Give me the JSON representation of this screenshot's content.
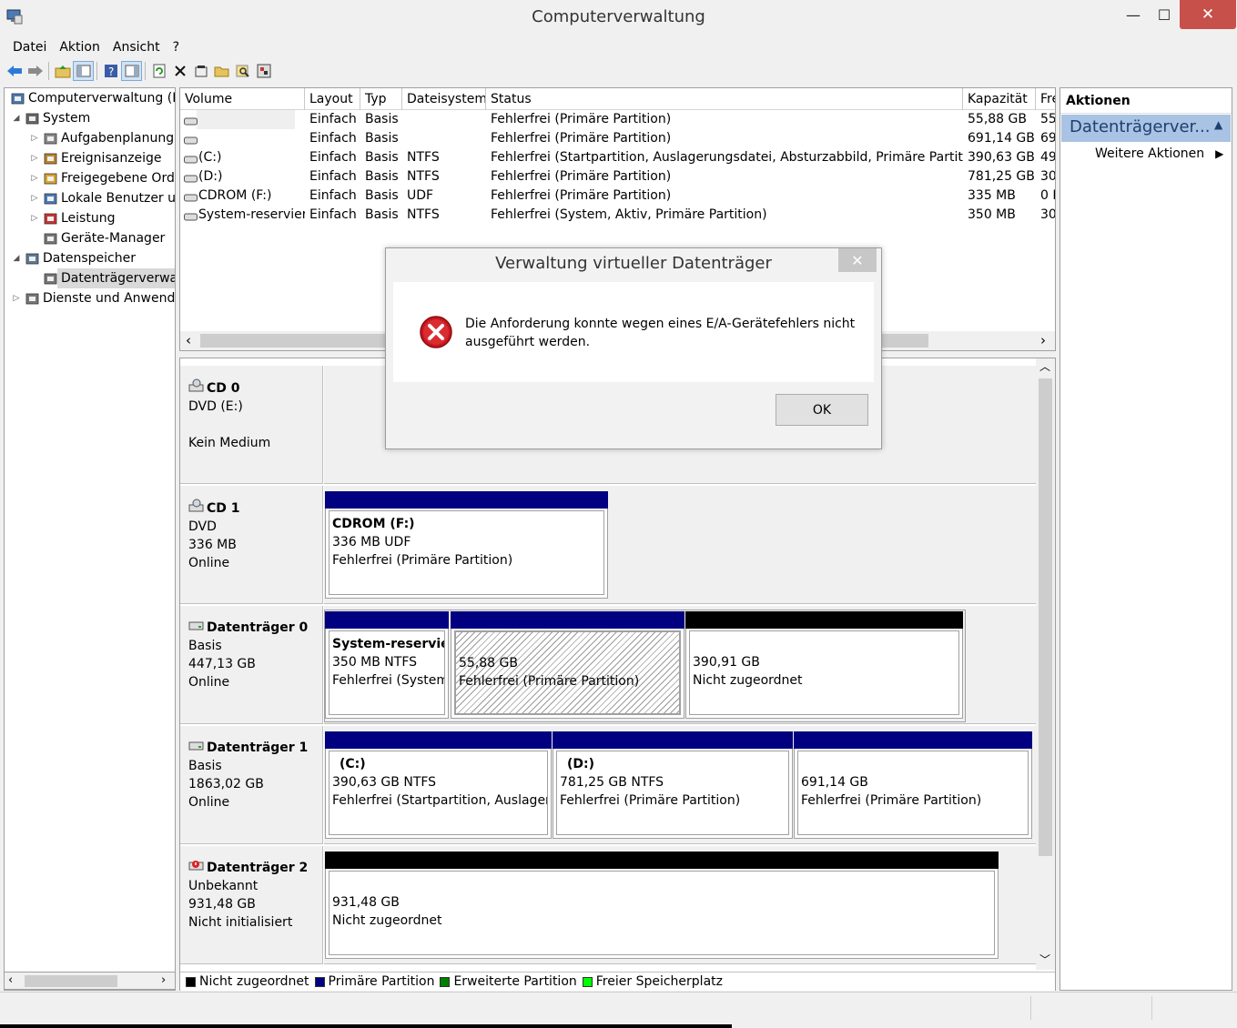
{
  "window": {
    "title": "Computerverwaltung"
  },
  "menu": [
    "Datei",
    "Aktion",
    "Ansicht",
    "?"
  ],
  "tree": {
    "items": [
      {
        "label": "Computerverwaltung (Lokal)",
        "level": 0,
        "arrow": "",
        "icon": "computer-management-icon"
      },
      {
        "label": "System",
        "level": 1,
        "arrow": "◢",
        "icon": "system-tools-icon"
      },
      {
        "label": "Aufgabenplanung",
        "level": 2,
        "arrow": "▷",
        "icon": "clock-icon"
      },
      {
        "label": "Ereignisanzeige",
        "level": 2,
        "arrow": "▷",
        "icon": "event-viewer-icon"
      },
      {
        "label": "Freigegebene Ordner",
        "level": 2,
        "arrow": "▷",
        "icon": "shared-folder-icon"
      },
      {
        "label": "Lokale Benutzer und Gruppen",
        "level": 2,
        "arrow": "▷",
        "icon": "users-icon"
      },
      {
        "label": "Leistung",
        "level": 2,
        "arrow": "▷",
        "icon": "performance-icon"
      },
      {
        "label": "Geräte-Manager",
        "level": 2,
        "arrow": "",
        "icon": "device-manager-icon"
      },
      {
        "label": "Datenspeicher",
        "level": 1,
        "arrow": "◢",
        "icon": "storage-icon"
      },
      {
        "label": "Datenträgerverwaltung",
        "level": 2,
        "arrow": "",
        "icon": "disk-management-icon",
        "selected": true
      },
      {
        "label": "Dienste und Anwendungen",
        "level": 1,
        "arrow": "▷",
        "icon": "services-icon"
      }
    ]
  },
  "volumes": {
    "columns": [
      "Volume",
      "Layout",
      "Typ",
      "Dateisystem",
      "Status",
      "Kapazität",
      "Fre"
    ],
    "rows": [
      [
        "",
        "Einfach",
        "Basis",
        "",
        "Fehlerfrei (Primäre Partition)",
        "55,88 GB",
        "55"
      ],
      [
        "",
        "Einfach",
        "Basis",
        "",
        "Fehlerfrei (Primäre Partition)",
        "691,14 GB",
        "69"
      ],
      [
        "(C:)",
        "Einfach",
        "Basis",
        "NTFS",
        "Fehlerfrei (Startpartition, Auslagerungsdatei, Absturzabbild, Primäre Partition)",
        "390,63 GB",
        "49"
      ],
      [
        "(D:)",
        "Einfach",
        "Basis",
        "NTFS",
        "Fehlerfrei (Primäre Partition)",
        "781,25 GB",
        "30"
      ],
      [
        "CDROM (F:)",
        "Einfach",
        "Basis",
        "UDF",
        "Fehlerfrei (Primäre Partition)",
        "335 MB",
        "0 M"
      ],
      [
        "System-reserviert",
        "Einfach",
        "Basis",
        "NTFS",
        "Fehlerfrei (System, Aktiv, Primäre Partition)",
        "350 MB",
        "30"
      ]
    ]
  },
  "disks": [
    {
      "name": "CD 0",
      "lines": [
        "DVD (E:)",
        "",
        "Kein Medium"
      ]
    },
    {
      "name": "CD 1",
      "lines": [
        "DVD",
        "336 MB",
        "Online"
      ]
    },
    {
      "name": "Datenträger 0",
      "lines": [
        "Basis",
        "447,13 GB",
        "Online"
      ]
    },
    {
      "name": "Datenträger 1",
      "lines": [
        "Basis",
        "1863,02 GB",
        "Online"
      ]
    },
    {
      "name": "Datenträger 2",
      "lines": [
        "Unbekannt",
        "931,48 GB",
        "Nicht initialisiert"
      ]
    }
  ],
  "partitions": {
    "cd1": {
      "title": "CDROM  (F:)",
      "l1": "336 MB UDF",
      "l2": "Fehlerfrei (Primäre Partition)"
    },
    "d0p1": {
      "title": "System-reserviert",
      "l1": "350 MB NTFS",
      "l2": "Fehlerfrei (System, Aktiv, Primäre Partition)"
    },
    "d0p2": {
      "title": "",
      "l1": "55,88 GB",
      "l2": "Fehlerfrei (Primäre Partition)"
    },
    "d0p3": {
      "title": "",
      "l1": "390,91 GB",
      "l2": "Nicht zugeordnet"
    },
    "d1p1": {
      "title": "(C:)",
      "l1": "390,63 GB NTFS",
      "l2": "Fehlerfrei (Startpartition, Auslagerungsdatei, Absturzabbild, Primäre Partition)"
    },
    "d1p2": {
      "title": "(D:)",
      "l1": "781,25 GB NTFS",
      "l2": "Fehlerfrei (Primäre Partition)"
    },
    "d1p3": {
      "title": "",
      "l1": "691,14 GB",
      "l2": "Fehlerfrei (Primäre Partition)"
    },
    "d2p1": {
      "title": "",
      "l1": "931,48 GB",
      "l2": "Nicht zugeordnet"
    }
  },
  "legend": [
    {
      "label": "Nicht zugeordnet",
      "color": "#000000"
    },
    {
      "label": "Primäre Partition",
      "color": "#000080"
    },
    {
      "label": "Erweiterte Partition",
      "color": "#008000"
    },
    {
      "label": "Freier Speicherplatz",
      "color": "#00ff00"
    }
  ],
  "actions": {
    "title": "Aktionen",
    "section": "Datenträgerver...",
    "more": "Weitere Aktionen"
  },
  "dialog": {
    "title": "Verwaltung virtueller Datenträger",
    "message": "Die Anforderung konnte wegen eines E/A-Gerätefehlers nicht ausgeführt werden.",
    "ok": "OK"
  },
  "colors": {
    "primary": "#000080",
    "unallocated": "#000000",
    "action_header": "#a8c3e3",
    "close_red": "#c7514a"
  }
}
